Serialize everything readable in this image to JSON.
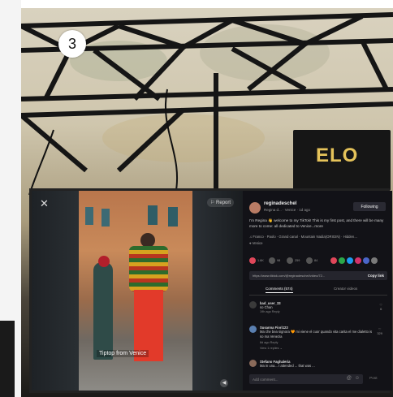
{
  "badge": {
    "number": "3"
  },
  "booth_logo": {
    "text": "ELO"
  },
  "tiktok": {
    "close_icon": "close-icon",
    "report_label": "Report",
    "video_caption": "Tiptop from Venice",
    "profile": {
      "username": "reginadeschel",
      "subtitle": "Regina d... · Venice · 1d ago",
      "follow_label": "Following",
      "description": "I'm Regina 👋 welcome to my TikTok! This is my first post, and there will be many more to come: all dedicated to Venice...more",
      "tags": "♫ Franco · Paolo · Grand canal · Mountain Nadia(ORIGIN) · Hidden...",
      "location": "Venice"
    },
    "actions": [
      {
        "icon": "heart-icon",
        "count": "1.6K",
        "color": "#e0475a"
      },
      {
        "icon": "comment-icon",
        "count": "98",
        "color": "#888888"
      },
      {
        "icon": "bookmark-icon",
        "count": "259",
        "color": "#888888"
      },
      {
        "icon": "share-icon",
        "count": "84",
        "color": "#888888"
      }
    ],
    "share_colors": [
      "#e0475a",
      "#2ba84a",
      "#1d9bf0",
      "#d3326a",
      "#4a66c8",
      "#7a7a7a"
    ],
    "link": {
      "url": "https://www.tiktok.com/@reginadeschel/video/72...",
      "copy_label": "Copy link"
    },
    "tabs": [
      {
        "label": "Comments (574)",
        "active": true
      },
      {
        "label": "Creator videos",
        "active": false
      }
    ],
    "comments": [
      {
        "name": "bad_user_33",
        "text": "so Chan",
        "meta": "19h ago   Reply",
        "likes": "6",
        "avatar_color": "#3a3a3a"
      },
      {
        "name": "Susanna Fiori123",
        "text": "Ma che bea signora 🧡 mi viene el cuor quando vita carita el me dialetto is so ma Venezia",
        "meta": "8d ago   Reply",
        "likes": "329",
        "view_replies": "View 1 replies ⌄",
        "avatar_color": "#5a7fb0"
      },
      {
        "name": "Stefano Faghaleria",
        "text": "Ma in una... I attended ... that was ...",
        "meta": "",
        "likes": "",
        "avatar_color": "#8a6a5a"
      }
    ],
    "add_comment_placeholder": "Add comment...",
    "post_label": "Post"
  }
}
